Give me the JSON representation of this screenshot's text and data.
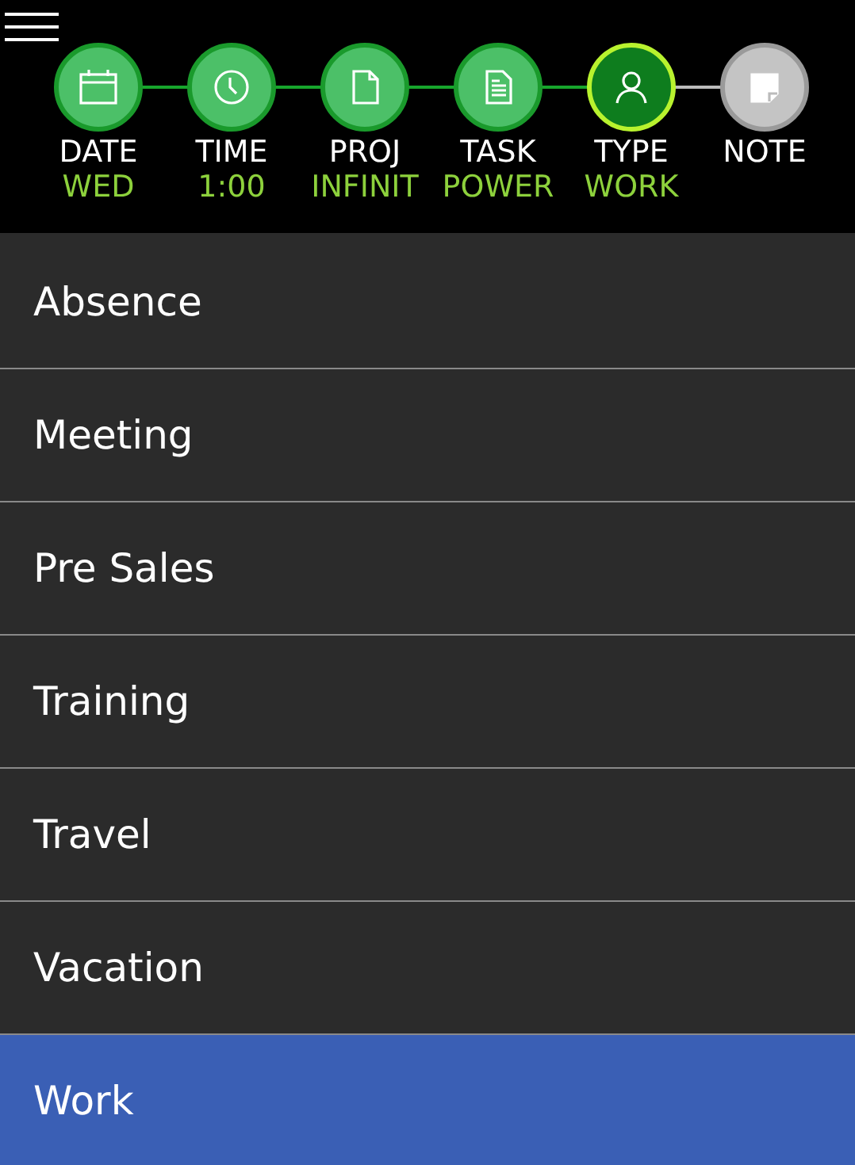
{
  "steps": [
    {
      "label": "DATE",
      "value": "WED",
      "kind": "done"
    },
    {
      "label": "TIME",
      "value": "1:00",
      "kind": "done"
    },
    {
      "label": "PROJ",
      "value": "INFINIT",
      "kind": "done"
    },
    {
      "label": "TASK",
      "value": "POWER",
      "kind": "done"
    },
    {
      "label": "TYPE",
      "value": "WORK",
      "kind": "current"
    },
    {
      "label": "NOTE",
      "kind": "pending"
    }
  ],
  "items": [
    {
      "label": "Absence",
      "selected": false
    },
    {
      "label": "Meeting",
      "selected": false
    },
    {
      "label": "Pre Sales",
      "selected": false
    },
    {
      "label": "Training",
      "selected": false
    },
    {
      "label": "Travel",
      "selected": false
    },
    {
      "label": "Vacation",
      "selected": false
    },
    {
      "label": "Work",
      "selected": true
    }
  ]
}
